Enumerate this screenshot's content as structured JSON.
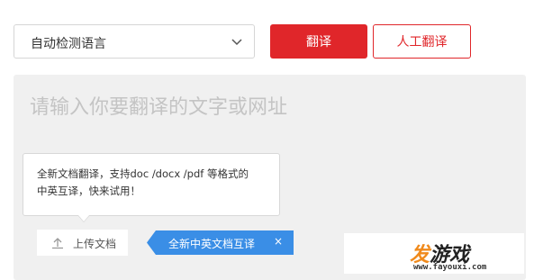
{
  "language_select": {
    "value": "自动检测语言"
  },
  "buttons": {
    "translate": "翻译",
    "human_translate": "人工翻译"
  },
  "input": {
    "placeholder": "请输入你要翻译的文字或网址"
  },
  "tooltip": {
    "line1": "全新文档翻译，支持doc /docx /pdf 等格式的",
    "line2": "中英互译，快来试用！"
  },
  "upload": {
    "label": "上传文档"
  },
  "badge": {
    "label": "全新中英文档互译",
    "close": "×"
  },
  "watermark": {
    "brand_part1": "发",
    "brand_part2": "游戏",
    "url": "www.fayouxi.com"
  },
  "colors": {
    "accent": "#e0262a",
    "badge_blue": "#3a8ee6",
    "input_bg": "#f0f0f0"
  }
}
